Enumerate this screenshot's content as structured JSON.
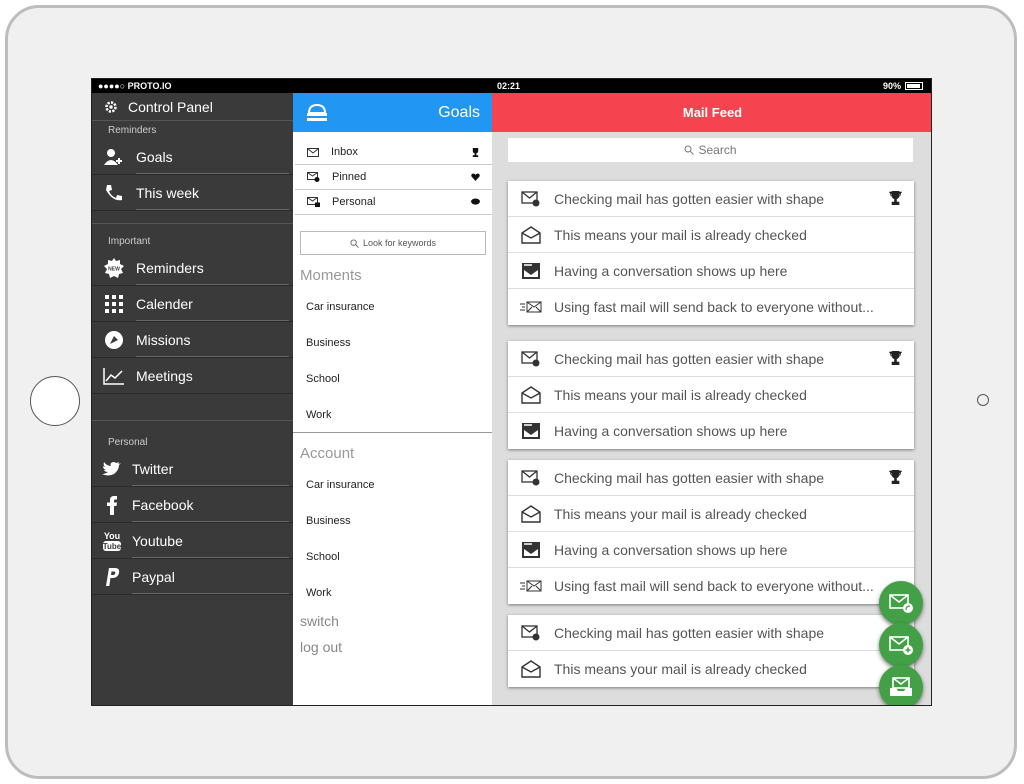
{
  "status": {
    "carrier": "●●●●○ PROTO.IO",
    "time": "02:21",
    "battery": "90%"
  },
  "sidebar": {
    "control_panel": "Control Panel",
    "sections": {
      "reminders": "Reminders",
      "important": "Important",
      "personal": "Personal"
    },
    "items": [
      {
        "label": "Goals",
        "icon": "add-user-icon"
      },
      {
        "label": "This week",
        "icon": "phone-icon"
      },
      {
        "label": "Reminders",
        "icon": "new-badge-icon"
      },
      {
        "label": "Calender",
        "icon": "grid-icon"
      },
      {
        "label": "Missions",
        "icon": "rocket-icon"
      },
      {
        "label": "Meetings",
        "icon": "chart-icon"
      },
      {
        "label": "Twitter",
        "icon": "twitter-icon"
      },
      {
        "label": "Facebook",
        "icon": "facebook-icon"
      },
      {
        "label": "Youtube",
        "icon": "youtube-icon"
      },
      {
        "label": "Paypal",
        "icon": "paypal-icon"
      }
    ]
  },
  "goals": {
    "title": "Goals",
    "folders": [
      "Inbox",
      "Pinned",
      "Personal"
    ],
    "keyword_placeholder": "Look for keywords",
    "moments_heading": "Moments",
    "moments": [
      "Car insurance",
      "Business",
      "School",
      "Work"
    ],
    "account_heading": "Account",
    "account": [
      "Car insurance",
      "Business",
      "School",
      "Work"
    ],
    "switch": "switch",
    "logout": "log out"
  },
  "feed": {
    "title": "Mail Feed",
    "search": "Search",
    "mails": {
      "a": "Checking mail has gotten easier with shape",
      "b": "This means your mail is already checked",
      "c": "Having a conversation shows up here",
      "d": "Using fast mail will send back to everyone without..."
    }
  },
  "colors": {
    "goals_header": "#2196f3",
    "feed_header": "#f5434f",
    "fab": "#43a047",
    "sidebar": "#3a3a3a"
  }
}
